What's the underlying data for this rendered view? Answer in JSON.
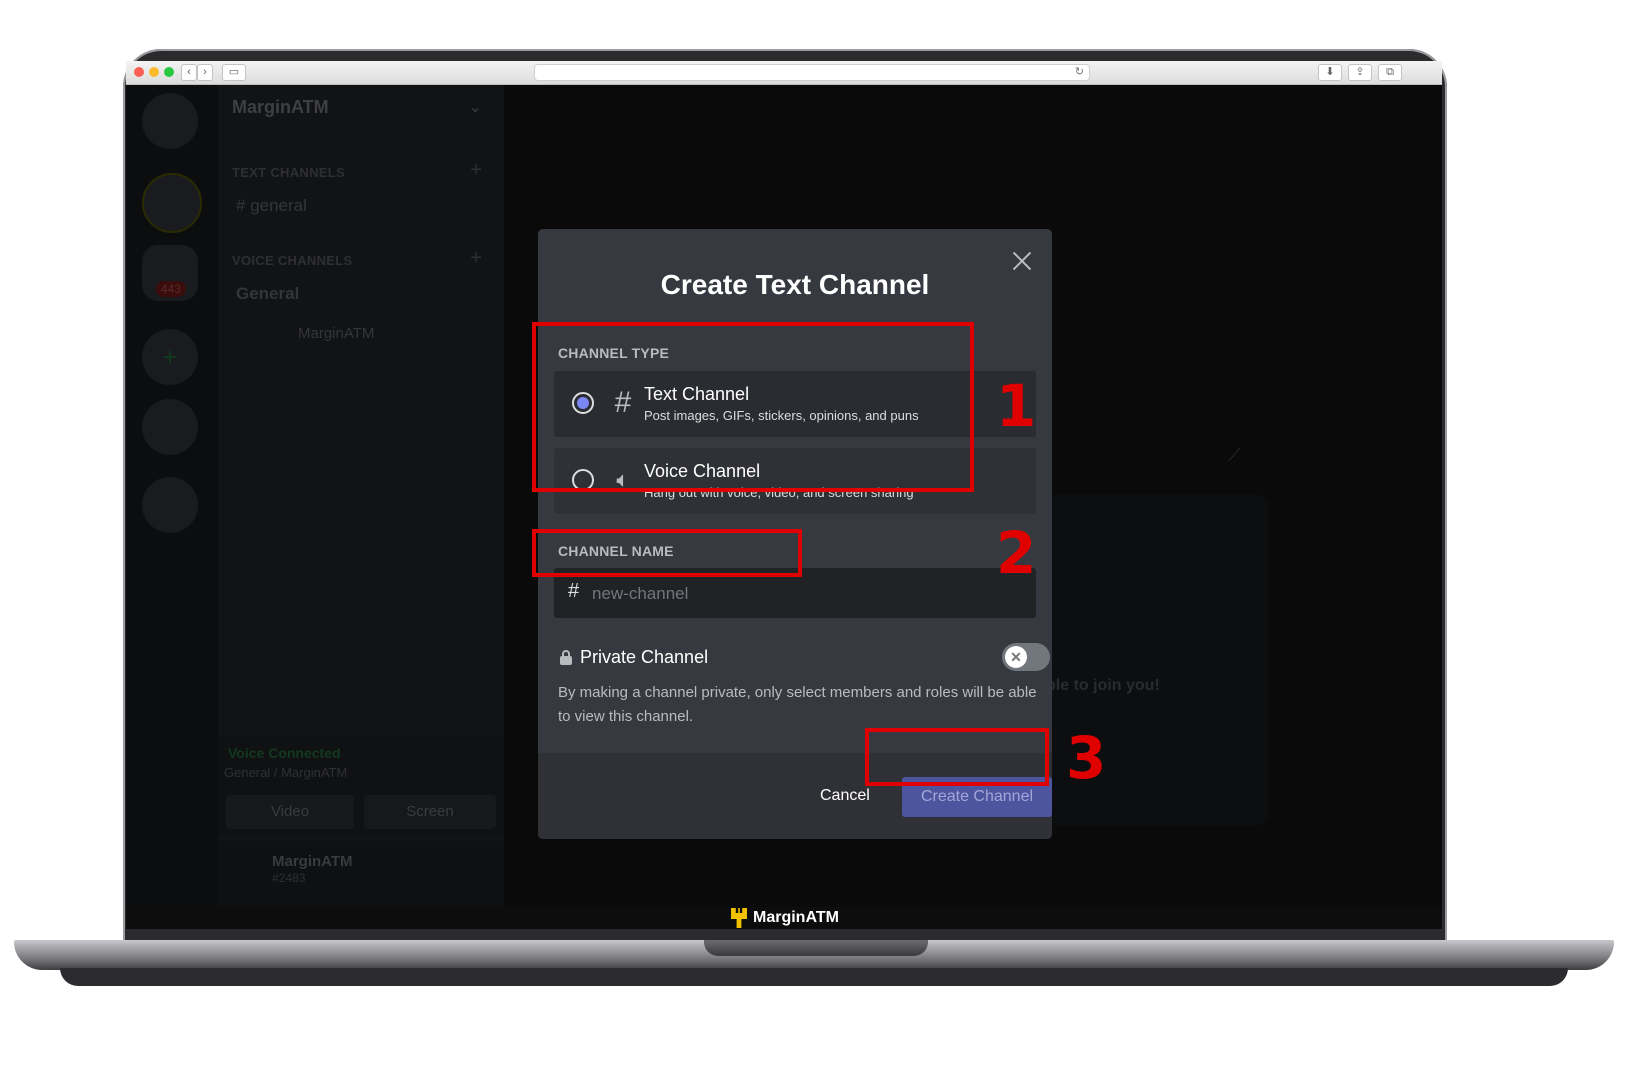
{
  "browser": {
    "nav_back": "‹",
    "nav_forward": "›",
    "reload_icon": "↻"
  },
  "server": {
    "name": "MarginATM",
    "badge": "443"
  },
  "sidebar": {
    "text_category": "TEXT CHANNELS",
    "text_channel": "general",
    "voice_category": "VOICE CHANNELS",
    "voice_channel": "General",
    "voice_member": "MarginATM"
  },
  "voice": {
    "status": "Voice Connected",
    "location": "General / MarginATM",
    "video_label": "Video",
    "screen_label": "Screen"
  },
  "user": {
    "name": "MarginATM",
    "tag": "#2483"
  },
  "main": {
    "invite_text": "ple to join you!"
  },
  "taskbar": {
    "app_name": "MarginATM"
  },
  "modal": {
    "title": "Create Text Channel",
    "channel_type_label": "CHANNEL TYPE",
    "options": [
      {
        "name": "Text Channel",
        "description": "Post images, GIFs, stickers, opinions, and puns",
        "selected": true,
        "icon": "hash-icon"
      },
      {
        "name": "Voice Channel",
        "description": "Hang out with voice, video, and screen sharing",
        "selected": false,
        "icon": "speaker-icon"
      }
    ],
    "channel_name_label": "CHANNEL NAME",
    "channel_name_placeholder": "new-channel",
    "channel_name_value": "",
    "private_title": "Private Channel",
    "private_enabled": false,
    "private_description": "By making a channel private, only select members and roles will be able to view this channel.",
    "cancel_label": "Cancel",
    "create_label": "Create Channel"
  },
  "annotations": {
    "step1": "1",
    "step2": "2",
    "step3": "3"
  },
  "colors": {
    "accent": "#5865f2",
    "annotation_red": "#e10000",
    "modal_bg": "#36393f"
  }
}
